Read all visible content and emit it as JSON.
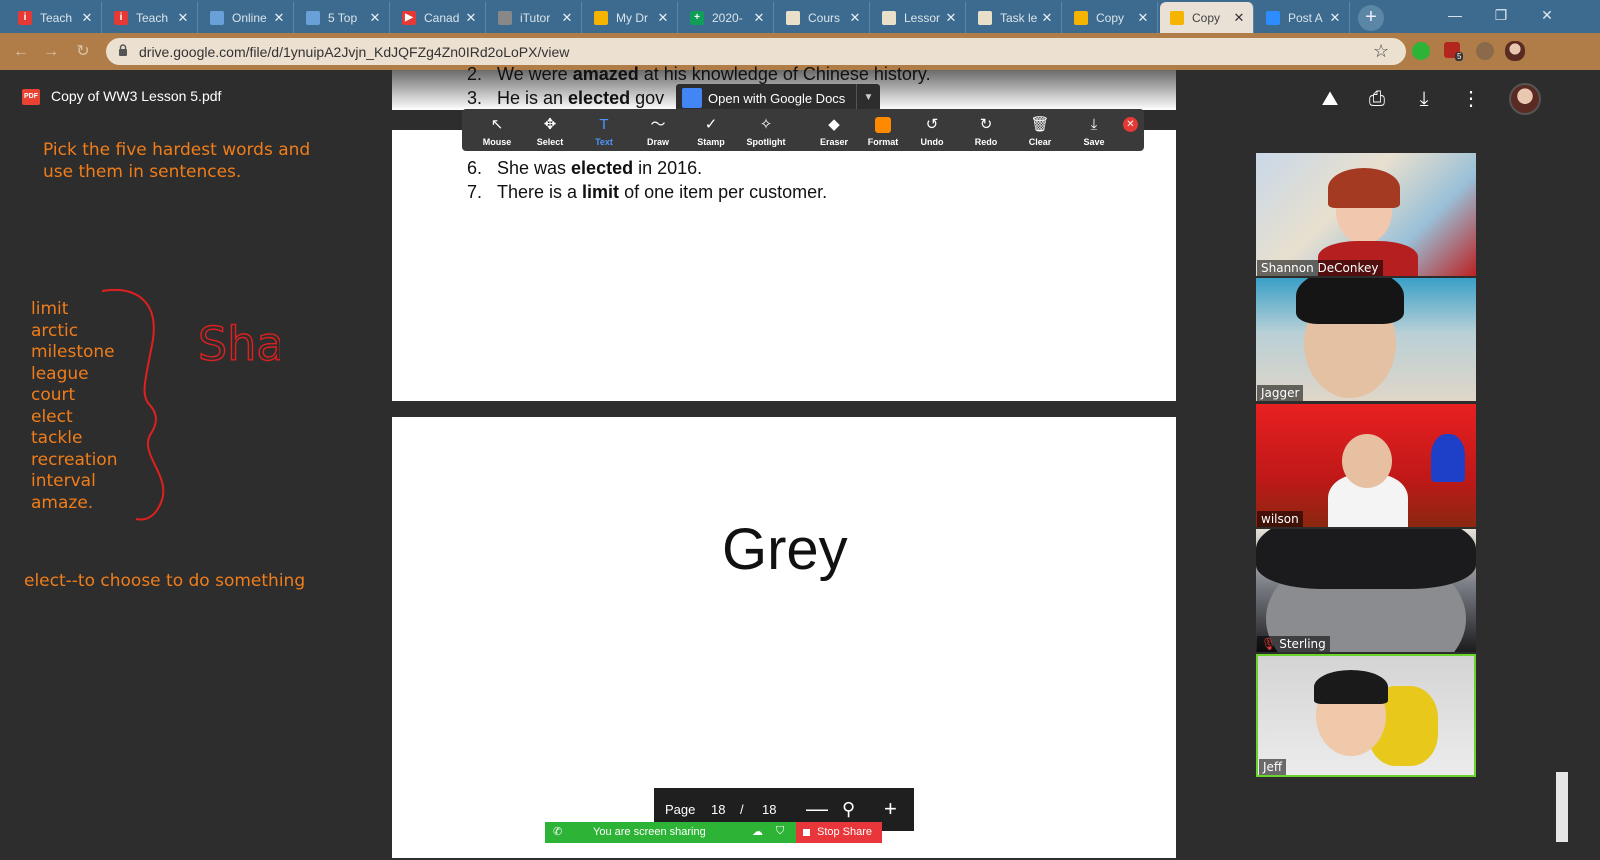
{
  "browser": {
    "tabs": [
      {
        "title": "Teach",
        "color": "#e53935",
        "glyph": "i",
        "active": false
      },
      {
        "title": "Teach",
        "color": "#e53935",
        "glyph": "i",
        "active": false
      },
      {
        "title": "Online",
        "color": "#6aa0d8",
        "glyph": "",
        "active": false
      },
      {
        "title": "5 Top",
        "color": "#6aa0d8",
        "glyph": "",
        "active": false
      },
      {
        "title": "Canad",
        "color": "#e53935",
        "glyph": "▶",
        "active": false
      },
      {
        "title": "iTutor",
        "color": "#888888",
        "glyph": "",
        "active": false
      },
      {
        "title": "My Dr",
        "color": "#f4b400",
        "glyph": "",
        "active": false
      },
      {
        "title": "2020-",
        "color": "#0f9d58",
        "glyph": "+",
        "active": false
      },
      {
        "title": "Cours",
        "color": "#e8e0c8",
        "glyph": "",
        "active": false
      },
      {
        "title": "Lessor",
        "color": "#e8e0c8",
        "glyph": "",
        "active": false
      },
      {
        "title": "Task le",
        "color": "#e8e0c8",
        "glyph": "",
        "active": false
      },
      {
        "title": "Copy",
        "color": "#f4b400",
        "glyph": "",
        "active": false
      },
      {
        "title": "Copy",
        "color": "#f4b400",
        "glyph": "",
        "active": true
      },
      {
        "title": "Post A",
        "color": "#2d8cff",
        "glyph": "",
        "active": false
      }
    ],
    "new_tab": "+",
    "window_controls": {
      "minimize": "—",
      "restore": "❐",
      "close": "✕"
    },
    "url": "drive.google.com/file/d/1ynuipA2Jvjn_KdJQFZg4Zn0IRd2oLoPX/view",
    "extension_badge": "5"
  },
  "viewer": {
    "doc_title": "Copy of WW3 Lesson 5.pdf",
    "pdf_badge": "PDF",
    "open_with": "Open with Google Docs",
    "list_lines": [
      {
        "num": "2.",
        "before": "We were ",
        "bold": "amazed",
        "after": " at his knowledge of Chinese history."
      },
      {
        "num": "3.",
        "before": "He is an ",
        "bold": "elected",
        "after": " gov"
      },
      {
        "num": "6.",
        "before": "She was ",
        "bold": "elected",
        "after": " in 2016."
      },
      {
        "num": "7.",
        "before": "There is a ",
        "bold": "limit",
        "after": " of one item per customer."
      }
    ],
    "slide_word": "Grey",
    "page_control": {
      "label": "Page",
      "current": "18",
      "sep": "/",
      "total": "18"
    }
  },
  "annotation_toolbar": {
    "tools": [
      {
        "label": "Mouse",
        "icon": "↖"
      },
      {
        "label": "Select",
        "icon": "✥"
      },
      {
        "label": "Text",
        "icon": "T"
      },
      {
        "label": "Draw",
        "icon": "〜"
      },
      {
        "label": "Stamp",
        "icon": "✓"
      },
      {
        "label": "Spotlight",
        "icon": "✧"
      },
      {
        "label": "Eraser",
        "icon": "◆"
      },
      {
        "label": "Format",
        "icon": ""
      },
      {
        "label": "Undo",
        "icon": "↺"
      },
      {
        "label": "Redo",
        "icon": "↻"
      },
      {
        "label": "Clear",
        "icon": "🗑"
      },
      {
        "label": "Save",
        "icon": "⤓"
      }
    ],
    "selected": "Text",
    "format_color": "#ff8a00"
  },
  "notes": {
    "prompt_line1": "Pick the five hardest words and",
    "prompt_line2": "use them in sentences.",
    "words": [
      "limit",
      "arctic",
      "milestone",
      "league",
      "court",
      "elect",
      "tackle",
      "recreation",
      "interval",
      "amaze."
    ],
    "definition": "elect--to choose to do something",
    "handwriting": "Sha",
    "ink_color": "#e02020",
    "text_color": "#f07d1a"
  },
  "share_bar": {
    "status": "You are screen sharing",
    "stop": "Stop Share"
  },
  "participants": [
    {
      "name": "Shannon DeConkey",
      "muted": false
    },
    {
      "name": "Jagger",
      "muted": false
    },
    {
      "name": "wilson",
      "muted": false
    },
    {
      "name": "Sterling",
      "muted": true
    },
    {
      "name": "Jeff",
      "muted": false
    }
  ]
}
